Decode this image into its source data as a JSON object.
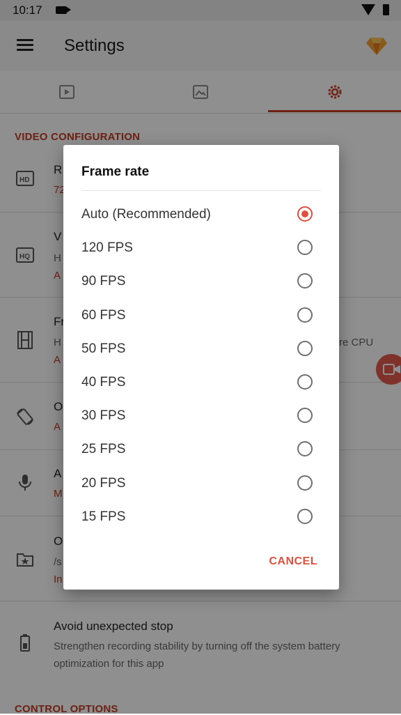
{
  "status_bar": {
    "time": "10:17"
  },
  "app_bar": {
    "title": "Settings"
  },
  "sections": {
    "video_configuration": "VIDEO CONFIGURATION",
    "control_options": "CONTROL OPTIONS"
  },
  "background_rows": {
    "resolution": {
      "title": "R",
      "value": "72"
    },
    "video_quality": {
      "title": "V",
      "sub": "H",
      "value": "A"
    },
    "frame_rate": {
      "title": "Fr",
      "sub": "H",
      "sub_right": "re CPU",
      "value": "A"
    },
    "orientation": {
      "title": "O",
      "value": "A"
    },
    "audio": {
      "title": "A",
      "value": "M"
    },
    "output": {
      "title": "O",
      "sub": "/s",
      "value": "In"
    },
    "avoid_stop": {
      "title": "Avoid unexpected stop",
      "sub_line1": "Strengthen recording stability by turning off the system battery",
      "sub_line2": "optimization for this app"
    }
  },
  "dialog": {
    "title": "Frame rate",
    "selected_index": 0,
    "options": [
      "Auto (Recommended)",
      "120 FPS",
      "90 FPS",
      "60 FPS",
      "50 FPS",
      "40 FPS",
      "30 FPS",
      "25 FPS",
      "20 FPS",
      "15 FPS"
    ],
    "cancel_label": "CANCEL"
  },
  "colors": {
    "accent": "#e0503d",
    "section": "#c23b22"
  },
  "icons": [
    "menu-icon",
    "gem-icon",
    "video-tab-icon",
    "image-tab-icon",
    "settings-tab-icon",
    "hd-icon",
    "film-icon",
    "rotate-icon",
    "mic-icon",
    "folder-star-icon",
    "battery-icon",
    "camera-fab-icon"
  ]
}
